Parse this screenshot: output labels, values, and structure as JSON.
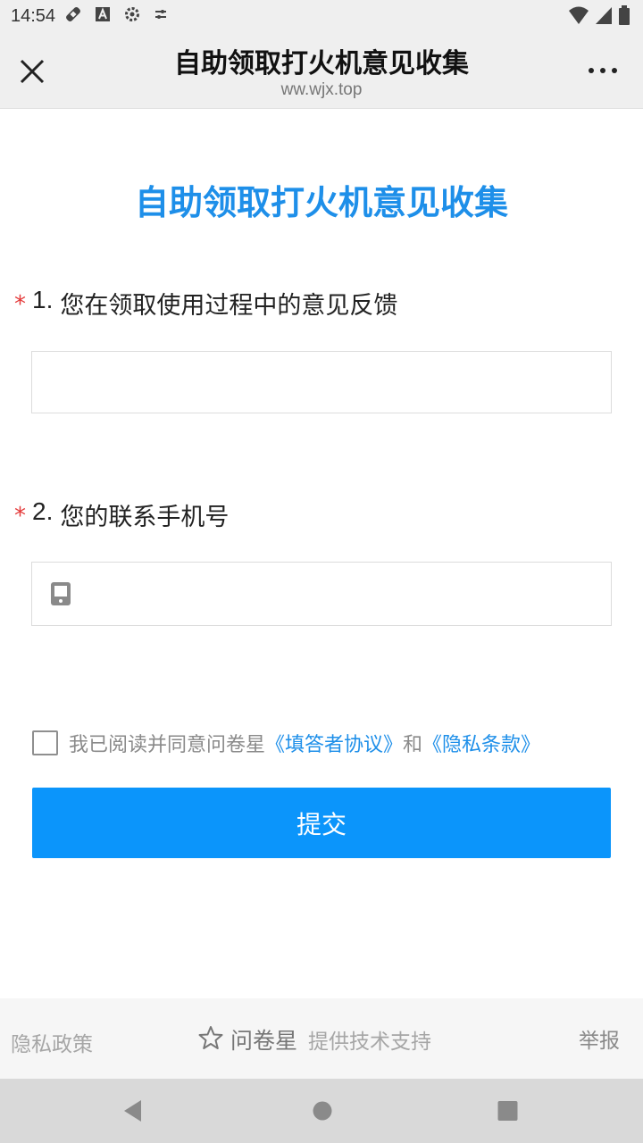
{
  "status_bar": {
    "time": "14:54",
    "icons": [
      "bandage-icon",
      "font-icon",
      "settings-icon",
      "sliders-icon",
      "wifi-icon",
      "signal-icon",
      "battery-icon"
    ]
  },
  "header": {
    "title": "自助领取打火机意见收集",
    "url": "ww.wjx.top",
    "close_icon": "close-icon",
    "more_icon": "more-icon"
  },
  "form": {
    "title": "自助领取打火机意见收集",
    "questions": [
      {
        "required_mark": "*",
        "number": "1.",
        "text": "您在领取使用过程中的意见反馈",
        "value": "",
        "placeholder": ""
      },
      {
        "required_mark": "*",
        "number": "2.",
        "text": "您的联系手机号",
        "value": "",
        "placeholder": "",
        "icon": "phone-icon"
      }
    ],
    "agreement": {
      "prefix": "我已阅读并同意问卷星",
      "link1": "《填答者协议》",
      "middle": "和",
      "link2": "《隐私条款》",
      "checked": false
    },
    "submit_label": "提交"
  },
  "footer": {
    "privacy": "隐私政策",
    "brand": "问卷星",
    "support": "提供技术支持",
    "report": "举报"
  },
  "colors": {
    "accent": "#1e8fe9",
    "button": "#0b95fb",
    "required": "#e43b3b"
  }
}
